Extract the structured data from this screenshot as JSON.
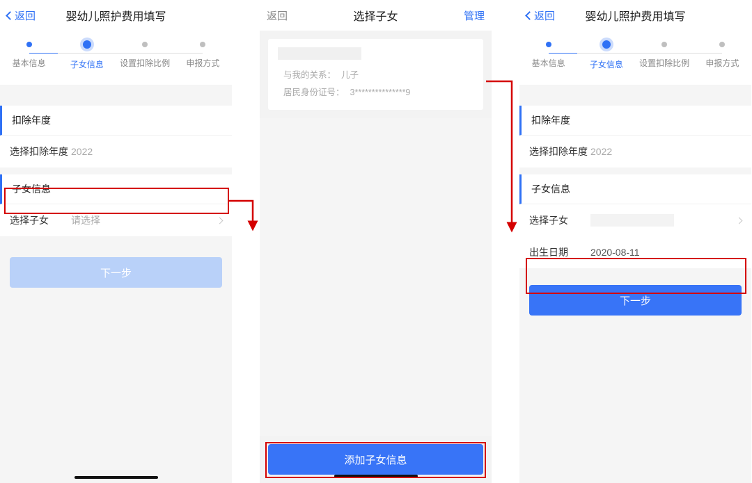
{
  "screen1": {
    "nav": {
      "back": "返回",
      "title": "婴幼儿照护费用填写"
    },
    "steps": [
      {
        "label": "基本信息",
        "state": "done"
      },
      {
        "label": "子女信息",
        "state": "current"
      },
      {
        "label": "设置扣除比例",
        "state": "todo"
      },
      {
        "label": "申报方式",
        "state": "todo"
      }
    ],
    "section_year_title": "扣除年度",
    "year_label": "选择扣除年度",
    "year_value": "2022",
    "section_child_title": "子女信息",
    "select_child_label": "选择子女",
    "select_child_placeholder": "请选择",
    "next_btn": "下一步"
  },
  "screen2": {
    "nav": {
      "back": "返回",
      "title": "选择子女",
      "right": "管理"
    },
    "card": {
      "relation_label": "与我的关系：",
      "relation_value": "儿子",
      "id_label": "居民身份证号：",
      "id_value": "3***************9"
    },
    "bottom_btn": "添加子女信息"
  },
  "screen3": {
    "nav": {
      "back": "返回",
      "title": "婴幼儿照护费用填写"
    },
    "steps": [
      {
        "label": "基本信息",
        "state": "done"
      },
      {
        "label": "子女信息",
        "state": "current"
      },
      {
        "label": "设置扣除比例",
        "state": "todo"
      },
      {
        "label": "申报方式",
        "state": "todo"
      }
    ],
    "section_year_title": "扣除年度",
    "year_label": "选择扣除年度",
    "year_value": "2022",
    "section_child_title": "子女信息",
    "select_child_label": "选择子女",
    "dob_label": "出生日期",
    "dob_value": "2020-08-11",
    "next_btn": "下一步"
  },
  "colors": {
    "accent": "#2f71f5",
    "highlight": "#d40000"
  }
}
